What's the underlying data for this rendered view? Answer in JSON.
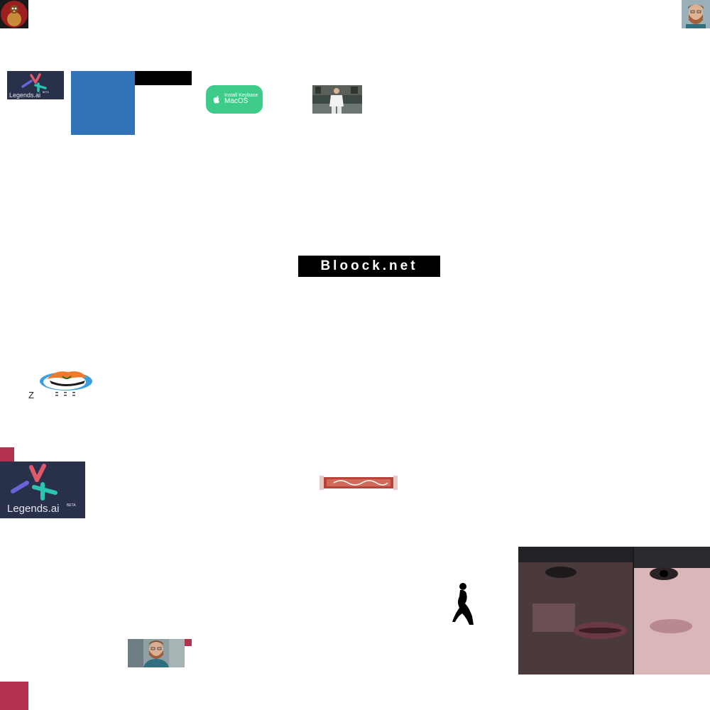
{
  "keybase_button": {
    "line1": "Install Keybase",
    "line2": "MacOS"
  },
  "bloock_banner": {
    "text": "Bloock.net"
  },
  "legends_logo": {
    "wordmark": "Legends.ai",
    "badge": "BETA"
  },
  "zzz_logo": {
    "letter": "Z"
  },
  "colors": {
    "keybase_green": "#3dcb8a",
    "legends_bg": "#28304a",
    "block_blue": "#3272b8",
    "accent_red": "#b3324f"
  }
}
